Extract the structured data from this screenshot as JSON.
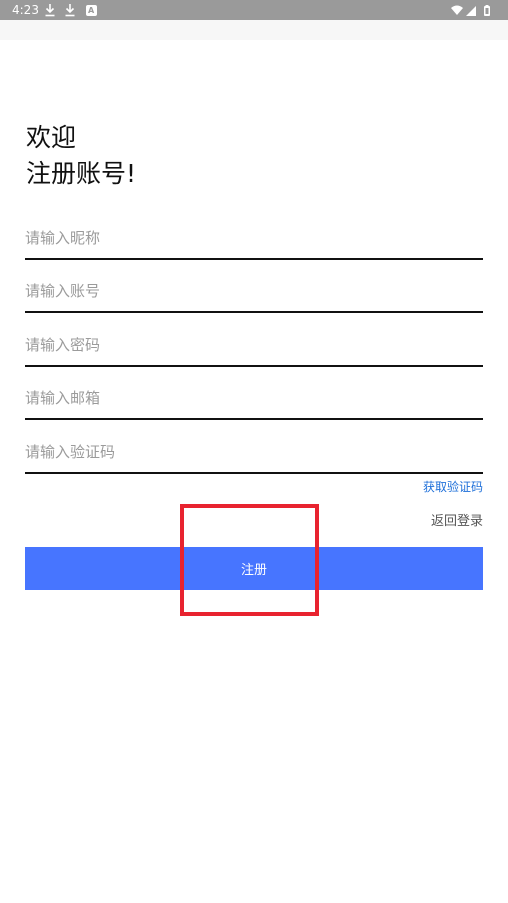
{
  "status_bar": {
    "time": "4:23",
    "badge_letter": "A"
  },
  "header": {
    "line1": "欢迎",
    "line2": "注册账号!"
  },
  "form": {
    "nickname_placeholder": "请输入昵称",
    "account_placeholder": "请输入账号",
    "password_placeholder": "请输入密码",
    "email_placeholder": "请输入邮箱",
    "code_placeholder": "请输入验证码",
    "get_code_label": "获取验证码",
    "back_login_label": "返回登录",
    "register_label": "注册"
  },
  "colors": {
    "status_bar_bg": "#9a9a9a",
    "accent": "#4775ff",
    "link": "#1e6fd9",
    "highlight": "#e8232f"
  },
  "icons": [
    "download-icon",
    "download-icon",
    "a-notification-icon",
    "wifi-icon",
    "signal-icon",
    "battery-icon"
  ]
}
